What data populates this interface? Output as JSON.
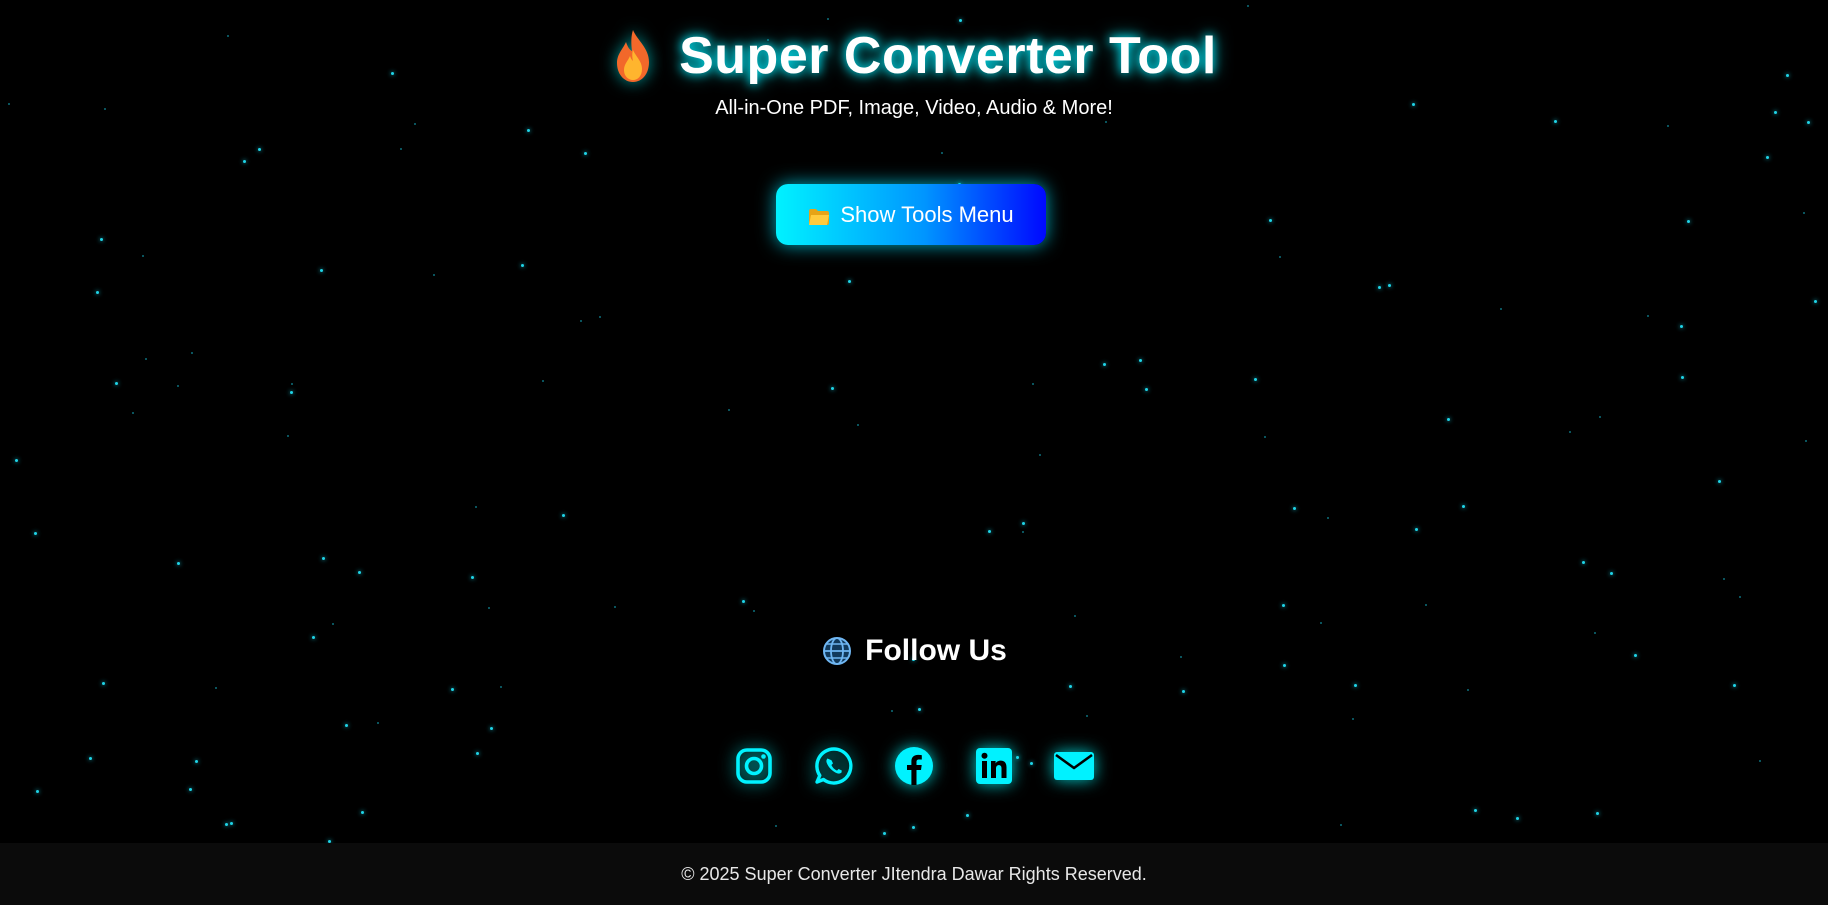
{
  "header": {
    "icon": "flame-icon",
    "title": "Super Converter Tool",
    "subtitle": "All-in-One PDF, Image, Video, Audio & More!"
  },
  "tools_button": {
    "icon": "folder-icon",
    "label": "Show Tools Menu"
  },
  "follow": {
    "icon": "globe-icon",
    "title": "Follow Us"
  },
  "socials": [
    {
      "name": "instagram-icon"
    },
    {
      "name": "whatsapp-icon"
    },
    {
      "name": "facebook-icon"
    },
    {
      "name": "linkedin-icon"
    },
    {
      "name": "email-icon"
    }
  ],
  "footer": {
    "text": "© 2025 Super Converter JItendra Dawar Rights Reserved."
  },
  "colors": {
    "background": "#000000",
    "accent": "#00f2ff",
    "button_gradient_end": "#0008ff",
    "star": "#1fd3e6",
    "footer_bg": "#0b0b0b"
  }
}
